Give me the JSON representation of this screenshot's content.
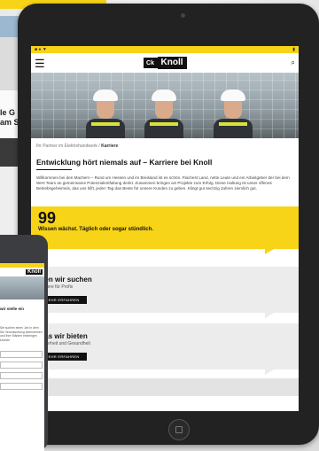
{
  "background": {
    "left_card_text": "le G\nam S"
  },
  "tablet": {
    "status_left": "■ ● ▼",
    "status_right": "▮",
    "logo_mark": "Ck",
    "logo_text": "Knoll",
    "breadcrumb_prefix": "Ihr Partner im Elektrohandwerk",
    "breadcrumb_current": "Karriere",
    "page_title": "Entwicklung hört niemals auf – Karriere bei Knoll",
    "intro_text": "Willkommen bei den Machern – Rund um Hessen und im Breisland ist es schön. Flachest Land, nette Leute und ein Arbeitgeber der bei dem Wert Team an gemeinsame Potenzialentfaltung denkt. Zusammen bringen wir Projekte zum Erfolg. Diese Haltung ist unser offenes Betriebsgeheimnis, das uns hilft, jeden Tag das Beste für unsere Kunden zu geben. Klingt gut sechzig Jahren ziemlich gut.",
    "quote": {
      "mark": "99",
      "text": "Wissen wächst. Täglich oder sogar stündlich."
    },
    "cards": [
      {
        "title": "Wen wir suchen",
        "subtitle": "Karriere für Profis",
        "button": "MEHR ERFAHREN"
      },
      {
        "title": "Was wir bieten",
        "subtitle": "Sicherheit und Gesundheit",
        "button": "MEHR ERFAHREN"
      }
    ]
  },
  "phone": {
    "logo_text": "Knoll",
    "heading": "wir stelle ein",
    "paragraph": "Sie suchen einen Job in dem Sie Verantwortung übernehmen und Ihre Stärken einbringen können"
  },
  "colors": {
    "brand_yellow": "#f7d417",
    "brand_black": "#111111"
  }
}
